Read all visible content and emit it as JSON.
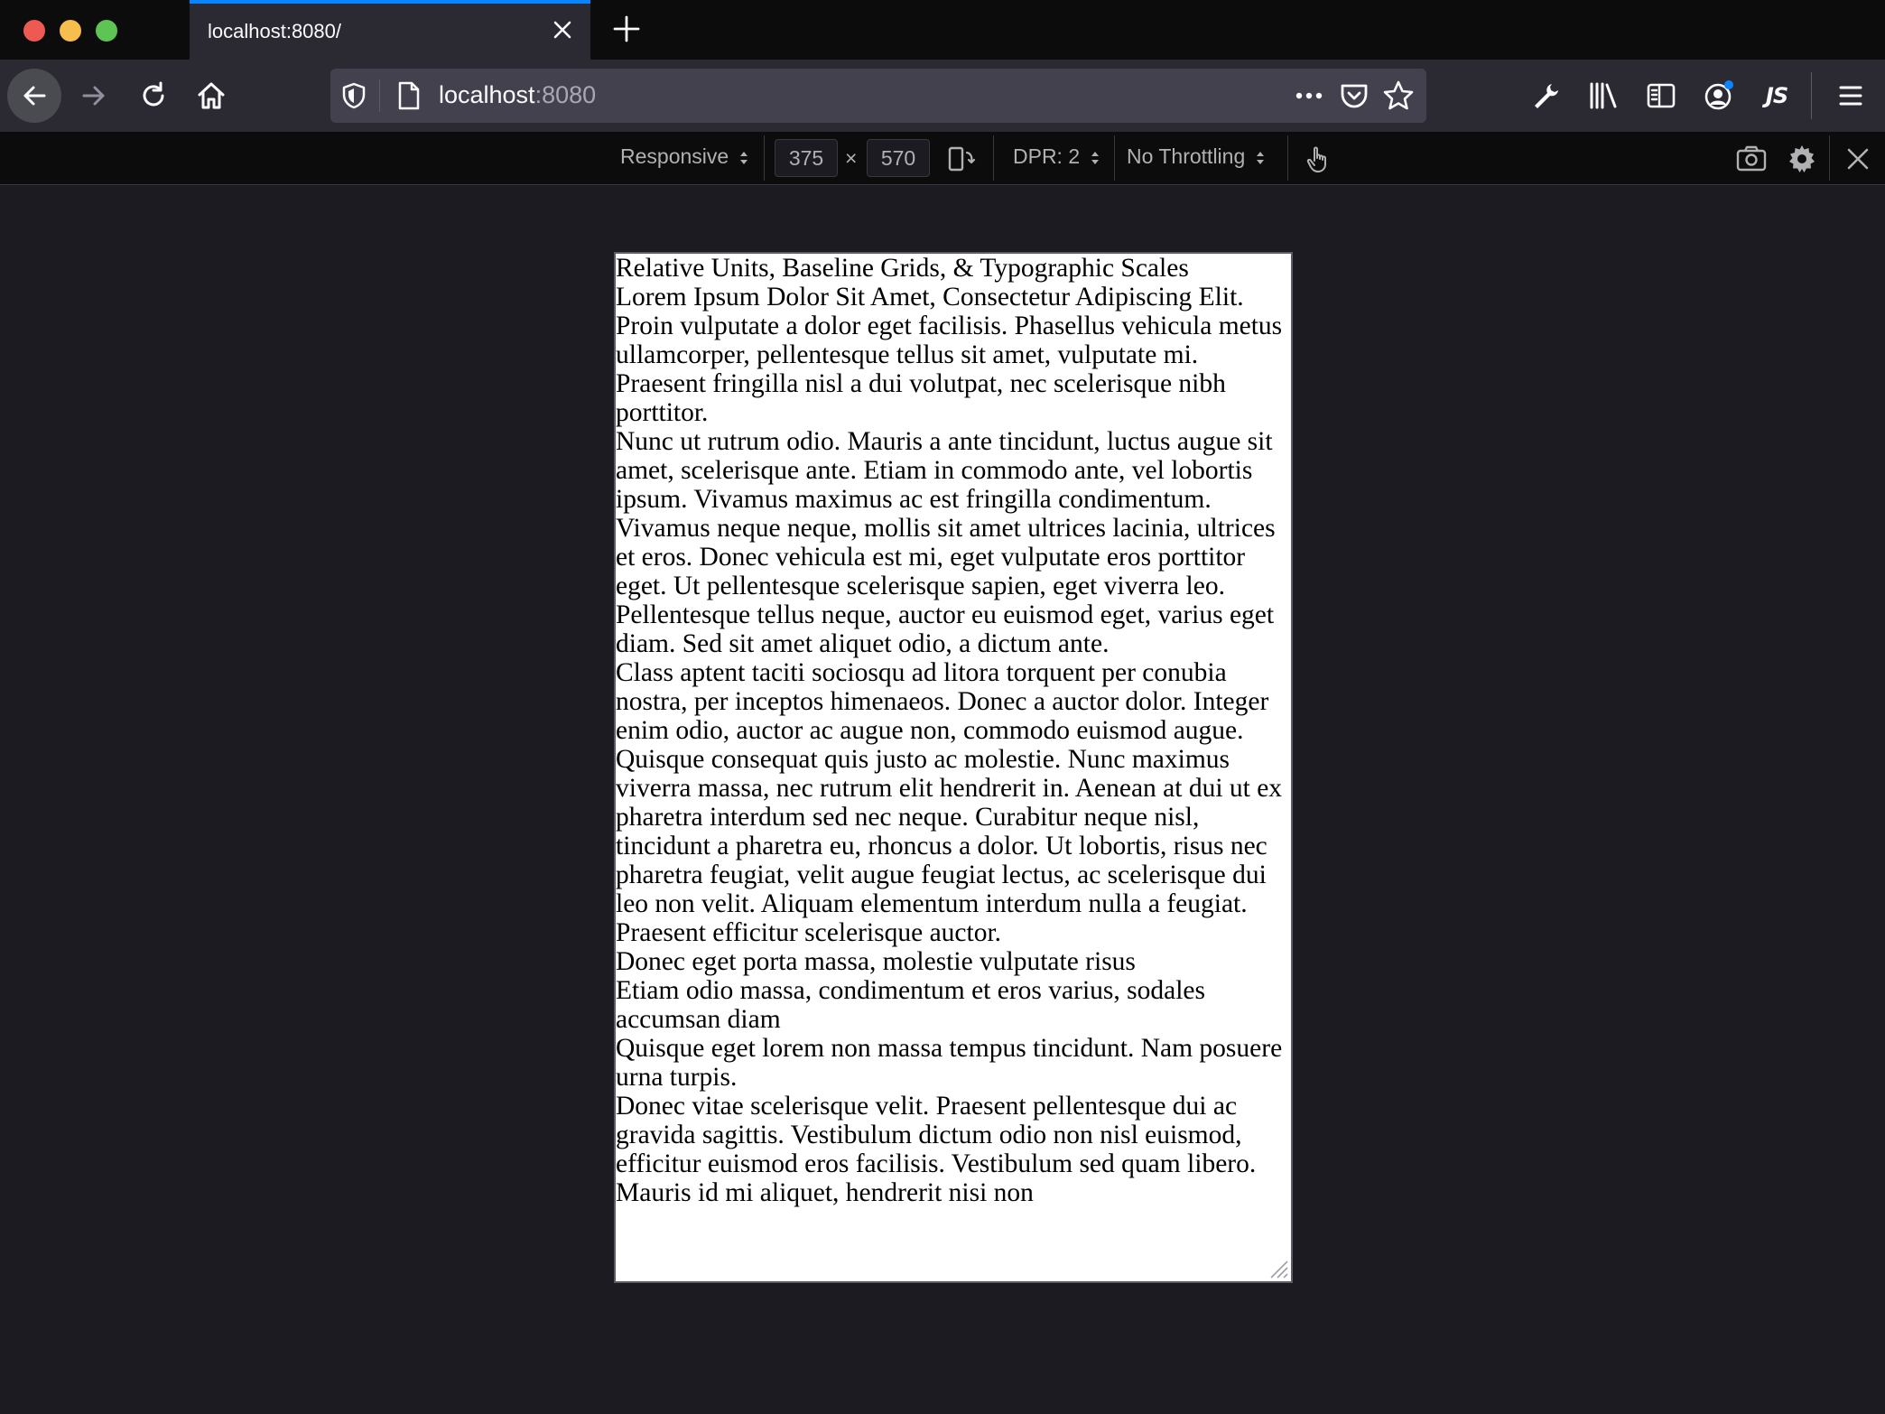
{
  "window": {
    "tab_title": "localhost:8080/"
  },
  "navbar": {
    "url_host": "localhost",
    "url_port": ":8080"
  },
  "toolbar_icons": [
    "wrench-icon",
    "library-icon",
    "sidebar-icon",
    "account-icon",
    "js-icon",
    "menu-icon"
  ],
  "toolbar": {
    "js_label": "JS"
  },
  "rdm": {
    "device": "Responsive",
    "width": "375",
    "times": "×",
    "height": "570",
    "dpr": "DPR: 2",
    "throttling": "No Throttling"
  },
  "document": {
    "heading": "Relative Units, Baseline Grids, & Typographic Scales",
    "subheading": "Lorem Ipsum Dolor Sit Amet, Consectetur Adipiscing Elit.",
    "paragraphs": [
      "Proin vulputate a dolor eget facilisis. Phasellus vehicula metus ullamcorper, pellentesque tellus sit amet, vulputate mi. Praesent fringilla nisl a dui volutpat, nec scelerisque nibh porttitor.",
      "Nunc ut rutrum odio. Mauris a ante tincidunt, luctus augue sit amet, scelerisque ante. Etiam in commodo ante, vel lobortis ipsum. Vivamus maximus ac est fringilla condimentum. Vivamus neque neque, mollis sit amet ultrices lacinia, ultrices et eros. Donec vehicula est mi, eget vulputate eros porttitor eget. Ut pellentesque scelerisque sapien, eget viverra leo. Pellentesque tellus neque, auctor eu euismod eget, varius eget diam. Sed sit amet aliquet odio, a dictum ante.",
      "Class aptent taciti sociosqu ad litora torquent per conubia nostra, per inceptos himenaeos. Donec a auctor dolor. Integer enim odio, auctor ac augue non, commodo euismod augue. Quisque consequat quis justo ac molestie. Nunc maximus viverra massa, nec rutrum elit hendrerit in. Aenean at dui ut ex pharetra interdum sed nec neque. Curabitur neque nisl, tincidunt a pharetra eu, rhoncus a dolor. Ut lobortis, risus nec pharetra feugiat, velit augue feugiat lectus, ac scelerisque dui leo non velit. Aliquam elementum interdum nulla a feugiat. Praesent efficitur scelerisque auctor.",
      "Donec eget porta massa, molestie vulputate risus",
      "Etiam odio massa, condimentum et eros varius, sodales accumsan diam",
      "Quisque eget lorem non massa tempus tincidunt. Nam posuere urna turpis.",
      "Donec vitae scelerisque velit. Praesent pellentesque dui ac gravida sagittis. Vestibulum dictum odio non nisl euismod, efficitur euismod eros facilisis. Vestibulum sed quam libero. Mauris id mi aliquet, hendrerit nisi non"
    ]
  }
}
